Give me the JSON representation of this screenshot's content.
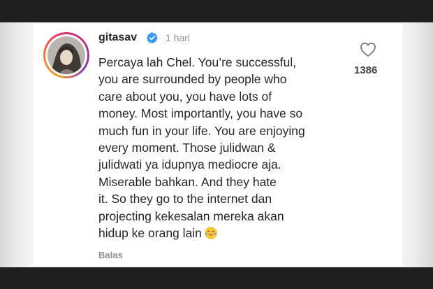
{
  "comment": {
    "username": "gitasav",
    "verified_icon": "verified-badge-icon",
    "time_ago": "1 hari",
    "lines": [
      "Percaya lah Chel. You’re successful,",
      "you are surrounded by people who",
      "care about you, you have lots of",
      "money. Most importantly, you have so",
      "much fun in your life. You are enjoying",
      "every moment. Those julidwan &",
      "julidwati ya idupnya mediocre aja.",
      "Miserable bahkan. And they hate",
      "it. So they go to the internet dan",
      "projecting kekesalan mereka akan",
      "hidup ke orang lain"
    ],
    "trailing_emoji": "tears-of-joy-emoji",
    "reply_label": "Balas"
  },
  "likes": {
    "icon": "heart-outline-icon",
    "count": "1386"
  },
  "colors": {
    "verified_blue": "#3897f0",
    "text": "#262626",
    "muted": "#8e8e8e"
  }
}
